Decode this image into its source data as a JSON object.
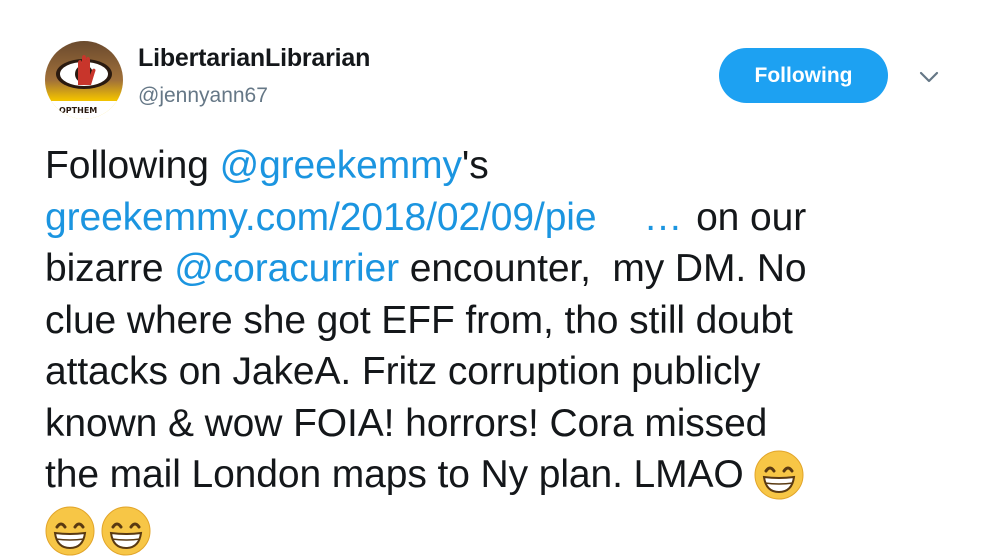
{
  "author": {
    "display_name": "LibertarianLibrarian",
    "handle": "@jennyann67",
    "avatar_text": "OPTHEM",
    "avatar_icon": "raised-hand-eye-icon"
  },
  "actions": {
    "follow_label": "Following",
    "menu_icon": "chevron-down-icon"
  },
  "tweet": {
    "line1": {
      "pre": "Following ",
      "mention": "@greekemmy",
      "post": "'s"
    },
    "line2": {
      "url": "greekemmy.com/2018/02/09/pie",
      "ellipsis": "…",
      "post": " on our"
    },
    "line3": {
      "pre": "bizarre ",
      "mention": "@coracurrier",
      "post": " encounter,  my DM. No"
    },
    "line4": "clue where she got EFF from, tho still doubt",
    "line5": "attacks on JakeA. Fritz corruption publicly",
    "line6": "known & wow FOIA! horrors! Cora missed",
    "line7": "the mail London maps to Ny plan. LMAO ",
    "emojis": [
      "grinning-face-icon",
      "grinning-face-icon",
      "grinning-face-icon"
    ]
  },
  "colors": {
    "link": "#1b95e0",
    "follow_button": "#1da1f2",
    "handle": "#657786"
  }
}
